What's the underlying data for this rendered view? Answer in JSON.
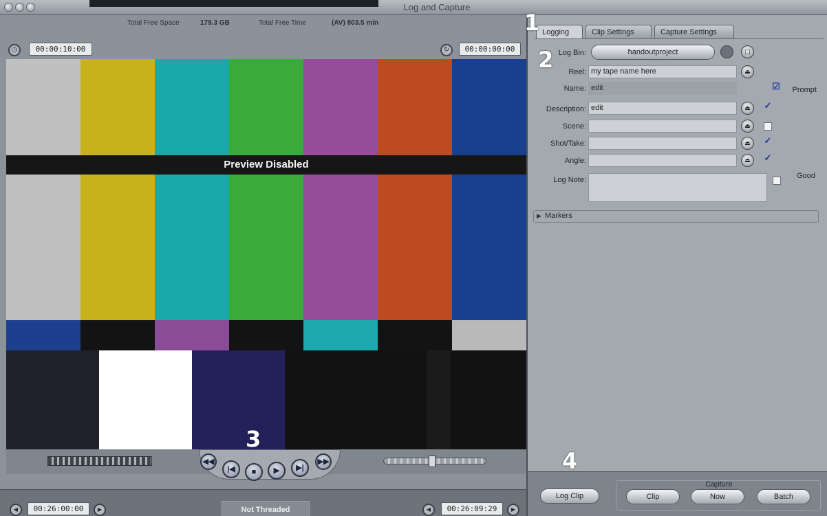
{
  "window": {
    "title": "Log and Capture"
  },
  "viewer": {
    "free_space_label": "Total Free Space",
    "free_space_value": "179.3 GB",
    "free_time_label": "Total Free Time",
    "free_time_value": "(AV) 803.5 min",
    "duration_tc": "00:00:10:00",
    "current_tc": "00:00:00:00",
    "preview_text": "Preview Disabled",
    "in_tc": "00:26:00:00",
    "out_tc": "00:26:09:29",
    "thread_status": "Not Threaded"
  },
  "tabs": [
    "Logging",
    "Clip Settings",
    "Capture Settings"
  ],
  "logging": {
    "bin_label": "Log Bin:",
    "bin_value": "handoutproject",
    "reel_label": "Reel:",
    "reel_value": "my tape name here",
    "name_label": "Name:",
    "name_value": "edit",
    "prompt_label": "Prompt",
    "description_label": "Description:",
    "description_value": "edit",
    "scene_label": "Scene:",
    "shot_label": "Shot/Take:",
    "angle_label": "Angle:",
    "lognote_label": "Log Note:",
    "good_label": "Good",
    "markers_label": "Markers"
  },
  "capture": {
    "log_clip": "Log Clip",
    "group_label": "Capture",
    "clip": "Clip",
    "now": "Now",
    "batch": "Batch"
  },
  "annotations": [
    "1",
    "2",
    "3",
    "4"
  ],
  "colors": {
    "bar_gray": "#c0c0c0",
    "bar_yellow": "#c6b21c",
    "bar_cyan": "#1aa9a8",
    "bar_green": "#38ab3b",
    "bar_magenta": "#954d9b",
    "bar_red": "#bf4a20",
    "bar_blue": "#18408f"
  }
}
